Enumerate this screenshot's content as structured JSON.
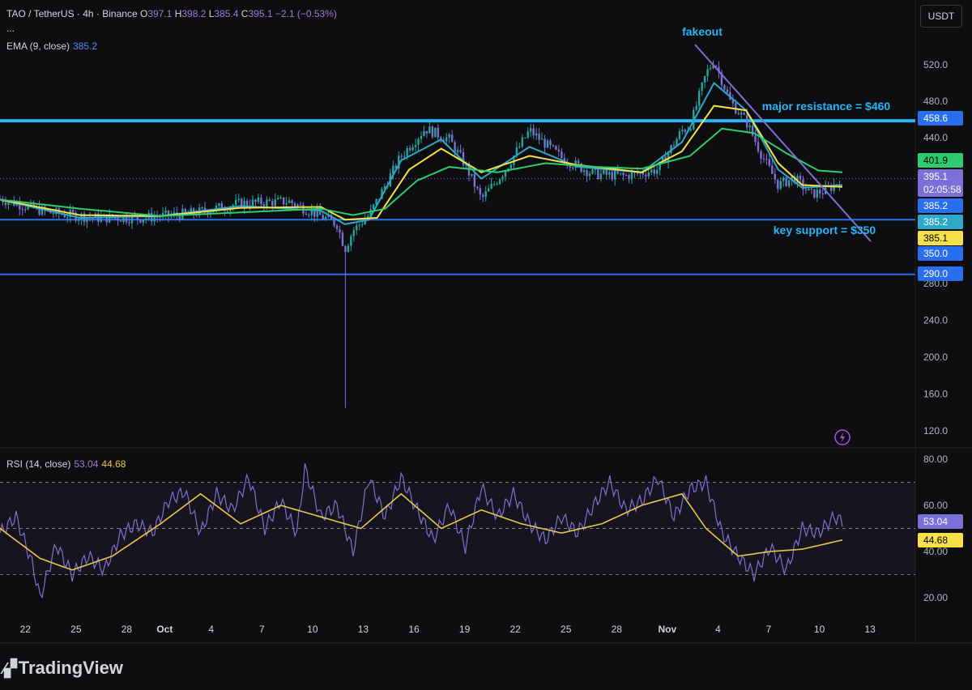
{
  "header": {
    "symbol": "TAO / TetherUS · 4h · Binance",
    "open_label": "O",
    "open": "397.1",
    "high_label": "H",
    "high": "398.2",
    "low_label": "L",
    "low": "385.4",
    "close_label": "C",
    "close": "395.1",
    "change": "−2.1 (−0.53%)",
    "more": "...",
    "ema_label": "EMA (9, close)",
    "ema_value": "385.2",
    "rsi_label": "RSI (14, close)",
    "rsi_value": "53.04",
    "rsi_ma_value": "44.68"
  },
  "currency_button": "USDT",
  "brand": "TradingView",
  "colors": {
    "background": "#0e0e10",
    "up": "#26a69a",
    "down": "#7b6fd8",
    "ema_cyan": "#2ea8c8",
    "ema_yellow": "#f5e04a",
    "ema_green": "#2ecc71",
    "hline": "#2a6ef0",
    "resistance": "#29b6f6",
    "trendline": "#7b6fd8",
    "rsi_line": "#7f6fd0",
    "rsi_ma": "#e6c84a",
    "annotation": "#29b6f6"
  },
  "chart_data": [
    {
      "type": "candlestick",
      "title": "TAO / TetherUS · 4h · Binance",
      "xlabel": "",
      "ylabel": "",
      "x_ticks": [
        "22",
        "25",
        "28",
        "Oct",
        "4",
        "7",
        "10",
        "13",
        "16",
        "19",
        "22",
        "25",
        "28",
        "Nov",
        "4",
        "7",
        "10",
        "13"
      ],
      "y_ticks": [
        520.0,
        480.0,
        440.0,
        280.0,
        240.0,
        200.0,
        160.0,
        120.0
      ],
      "ylim": [
        100,
        550
      ],
      "approx_close_path": [
        [
          0,
          373
        ],
        [
          6,
          358
        ],
        [
          12,
          352
        ],
        [
          18,
          352
        ],
        [
          24,
          357
        ],
        [
          30,
          368
        ],
        [
          36,
          370
        ],
        [
          40,
          354
        ],
        [
          42,
          345
        ],
        [
          43,
          318
        ],
        [
          44,
          338
        ],
        [
          46,
          355
        ],
        [
          50,
          420
        ],
        [
          53,
          450
        ],
        [
          56,
          438
        ],
        [
          58,
          410
        ],
        [
          60,
          372
        ],
        [
          63,
          405
        ],
        [
          66,
          448
        ],
        [
          70,
          418
        ],
        [
          74,
          400
        ],
        [
          78,
          398
        ],
        [
          82,
          405
        ],
        [
          85,
          448
        ],
        [
          86,
          452
        ],
        [
          88,
          510
        ],
        [
          89,
          525
        ],
        [
          91,
          480
        ],
        [
          93,
          458
        ],
        [
          95,
          420
        ],
        [
          97,
          388
        ],
        [
          99,
          396
        ],
        [
          101,
          378
        ],
        [
          103,
          382
        ],
        [
          105,
          395
        ]
      ],
      "series": [
        {
          "name": "EMA (9, close)",
          "last": 385.2,
          "path": [
            [
              0,
              372
            ],
            [
              10,
              352
            ],
            [
              20,
              354
            ],
            [
              30,
              365
            ],
            [
              40,
              360
            ],
            [
              43,
              345
            ],
            [
              46,
              350
            ],
            [
              50,
              415
            ],
            [
              55,
              438
            ],
            [
              60,
              395
            ],
            [
              66,
              430
            ],
            [
              72,
              408
            ],
            [
              80,
              402
            ],
            [
              85,
              435
            ],
            [
              89,
              500
            ],
            [
              93,
              470
            ],
            [
              97,
              405
            ],
            [
              100,
              385
            ],
            [
              105,
              388
            ]
          ]
        },
        {
          "name": "",
          "last": 385.1,
          "path": [
            [
              0,
              372
            ],
            [
              10,
              355
            ],
            [
              20,
              354
            ],
            [
              30,
              363
            ],
            [
              40,
              364
            ],
            [
              43,
              350
            ],
            [
              47,
              352
            ],
            [
              51,
              405
            ],
            [
              55,
              428
            ],
            [
              60,
              402
            ],
            [
              66,
              420
            ],
            [
              72,
              410
            ],
            [
              80,
              402
            ],
            [
              85,
              425
            ],
            [
              89,
              475
            ],
            [
              93,
              470
            ],
            [
              97,
              412
            ],
            [
              100,
              388
            ],
            [
              105,
              386
            ]
          ]
        },
        {
          "name": "",
          "last": 401.9,
          "path": [
            [
              0,
              372
            ],
            [
              10,
              362
            ],
            [
              20,
              354
            ],
            [
              30,
              358
            ],
            [
              40,
              362
            ],
            [
              44,
              355
            ],
            [
              48,
              362
            ],
            [
              52,
              393
            ],
            [
              56,
              408
            ],
            [
              62,
              402
            ],
            [
              68,
              412
            ],
            [
              74,
              408
            ],
            [
              80,
              406
            ],
            [
              86,
              420
            ],
            [
              90,
              450
            ],
            [
              94,
              445
            ],
            [
              98,
              423
            ],
            [
              102,
              404
            ],
            [
              105,
              402
            ]
          ]
        }
      ],
      "price_labels": [
        {
          "label": "458.6",
          "value": 458.6
        },
        {
          "label": "401.9",
          "value": 401.9
        },
        {
          "label": "395.1",
          "value": 395.1,
          "countdown": "02:05:58"
        },
        {
          "label": "385.2",
          "value": 385.2
        },
        {
          "label": "385.2",
          "value": 385.2
        },
        {
          "label": "385.1",
          "value": 385.1
        },
        {
          "label": "350.0",
          "value": 350.0
        },
        {
          "label": "290.0",
          "value": 290.0
        }
      ],
      "horizontal_lines": [
        {
          "value": 458.6,
          "label": "major resistance = $460"
        },
        {
          "value": 350.0,
          "label": "key support = $350"
        },
        {
          "value": 290.0,
          "label": ""
        }
      ],
      "annotations": [
        {
          "text": "fakeout"
        },
        {
          "text": "major resistance = $460"
        },
        {
          "text": "key support = $350"
        }
      ]
    },
    {
      "type": "line",
      "title": "RSI (14, close)",
      "y_ticks": [
        80.0,
        60.0,
        40.0,
        20.0
      ],
      "ylim": [
        10,
        85
      ],
      "bands": [
        70,
        50,
        30
      ],
      "series": [
        {
          "name": "RSI (14, close)",
          "last": 53.04,
          "path": [
            [
              0,
              48
            ],
            [
              2,
              55
            ],
            [
              4,
              35
            ],
            [
              5,
              20
            ],
            [
              7,
              43
            ],
            [
              9,
              30
            ],
            [
              11,
              38
            ],
            [
              13,
              32
            ],
            [
              15,
              47
            ],
            [
              17,
              52
            ],
            [
              19,
              48
            ],
            [
              21,
              62
            ],
            [
              23,
              66
            ],
            [
              25,
              48
            ],
            [
              27,
              65
            ],
            [
              29,
              58
            ],
            [
              31,
              72
            ],
            [
              33,
              50
            ],
            [
              35,
              62
            ],
            [
              37,
              48
            ],
            [
              38,
              76
            ],
            [
              40,
              55
            ],
            [
              42,
              60
            ],
            [
              44,
              40
            ],
            [
              46,
              72
            ],
            [
              48,
              55
            ],
            [
              50,
              72
            ],
            [
              52,
              58
            ],
            [
              54,
              45
            ],
            [
              56,
              60
            ],
            [
              58,
              42
            ],
            [
              60,
              68
            ],
            [
              62,
              55
            ],
            [
              64,
              65
            ],
            [
              66,
              52
            ],
            [
              68,
              45
            ],
            [
              70,
              55
            ],
            [
              72,
              48
            ],
            [
              74,
              60
            ],
            [
              76,
              70
            ],
            [
              78,
              58
            ],
            [
              80,
              62
            ],
            [
              82,
              72
            ],
            [
              84,
              55
            ],
            [
              86,
              67
            ],
            [
              88,
              70
            ],
            [
              90,
              48
            ],
            [
              92,
              38
            ],
            [
              94,
              30
            ],
            [
              96,
              42
            ],
            [
              98,
              32
            ],
            [
              100,
              50
            ],
            [
              102,
              48
            ],
            [
              104,
              55
            ],
            [
              105,
              53
            ]
          ]
        },
        {
          "name": "",
          "last": 44.68,
          "path": [
            [
              0,
              50
            ],
            [
              5,
              37
            ],
            [
              9,
              32
            ],
            [
              14,
              38
            ],
            [
              20,
              52
            ],
            [
              25,
              65
            ],
            [
              30,
              52
            ],
            [
              35,
              60
            ],
            [
              40,
              55
            ],
            [
              45,
              50
            ],
            [
              50,
              65
            ],
            [
              55,
              50
            ],
            [
              60,
              58
            ],
            [
              65,
              52
            ],
            [
              70,
              48
            ],
            [
              75,
              52
            ],
            [
              80,
              60
            ],
            [
              85,
              65
            ],
            [
              88,
              50
            ],
            [
              92,
              38
            ],
            [
              96,
              40
            ],
            [
              100,
              41
            ],
            [
              105,
              45
            ]
          ]
        }
      ],
      "price_labels": [
        {
          "label": "53.04",
          "value": 53.04
        },
        {
          "label": "44.68",
          "value": 44.68
        }
      ]
    }
  ]
}
